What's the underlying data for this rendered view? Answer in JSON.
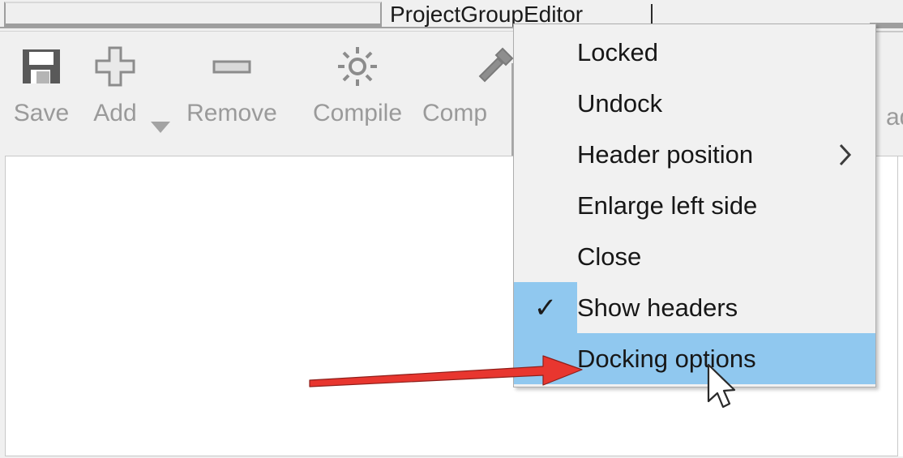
{
  "window": {
    "active_tab_label": "ProjectGroupEditor",
    "inactive_tab_label": ""
  },
  "toolbar": {
    "buttons": [
      {
        "label": "Save",
        "icon": "save-floppy-icon"
      },
      {
        "label": "Add",
        "icon": "plus-icon",
        "has_dropdown": true
      },
      {
        "label": "Remove",
        "icon": "minus-icon"
      },
      {
        "label": "Compile",
        "icon": "gear-icon"
      },
      {
        "label": "Comp",
        "icon": "build-hammer-icon"
      }
    ],
    "right_partial_label": "ad"
  },
  "context_menu": {
    "items": [
      {
        "label": "Locked",
        "checked": false,
        "highlighted": false,
        "submenu": false
      },
      {
        "label": "Undock",
        "checked": false,
        "highlighted": false,
        "submenu": false
      },
      {
        "label": "Header position",
        "checked": false,
        "highlighted": false,
        "submenu": true
      },
      {
        "label": "Enlarge left side",
        "checked": false,
        "highlighted": false,
        "submenu": false
      },
      {
        "label": "Close",
        "checked": false,
        "highlighted": false,
        "submenu": false
      },
      {
        "label": "Show headers",
        "checked": true,
        "highlighted": false,
        "submenu": false
      },
      {
        "label": "Docking options",
        "checked": false,
        "highlighted": true,
        "submenu": false
      }
    ],
    "check_glyph": "✓",
    "submenu_glyph": "›",
    "highlight_color": "#90c8ef",
    "background_color": "#f1f1f1"
  },
  "annotations": {
    "arrow_color": "#e8362f",
    "arrow_name": "red-pointer-arrow",
    "cursor_name": "mouse-cursor"
  }
}
